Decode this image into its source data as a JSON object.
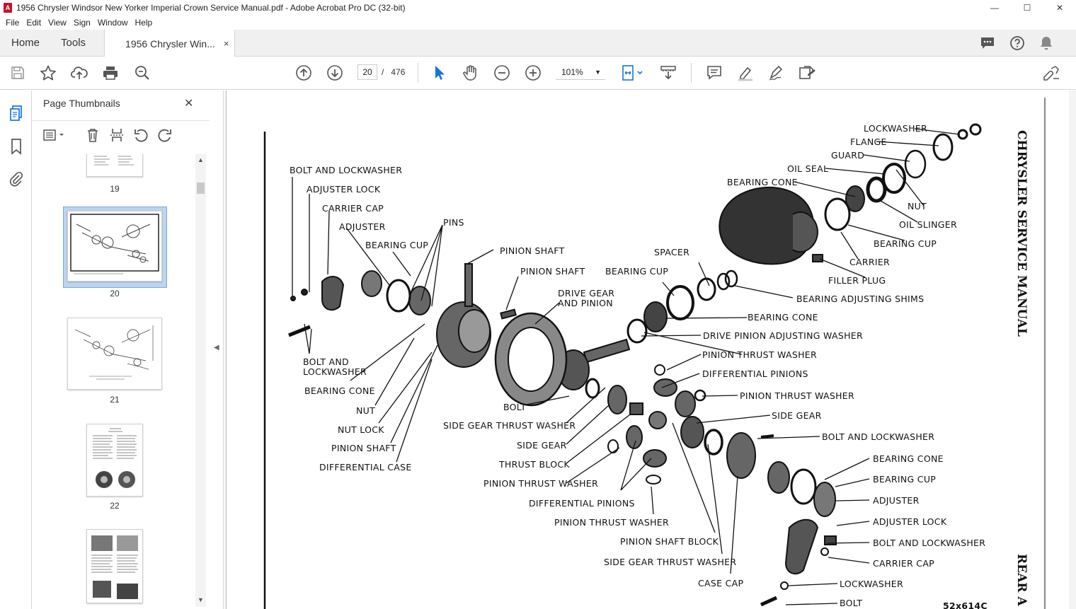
{
  "window": {
    "title": "1956 Chrysler Windsor New Yorker Imperial Crown Service Manual.pdf - Adobe Acrobat Pro DC (32-bit)",
    "app_icon": "A",
    "minimize": "—",
    "maximize": "☐",
    "close": "✕"
  },
  "menu": [
    "File",
    "Edit",
    "View",
    "Sign",
    "Window",
    "Help"
  ],
  "tabs": {
    "home": "Home",
    "tools": "Tools",
    "doc": "1956 Chrysler Win...",
    "doc_close": "×"
  },
  "toolbar": {
    "page_current": "20",
    "page_sep": "/",
    "page_total": "476",
    "zoom": "101%"
  },
  "panel": {
    "title": "Page Thumbnails",
    "close": "✕",
    "thumbnails": [
      {
        "label": "19"
      },
      {
        "label": "20",
        "selected": true
      },
      {
        "label": "21"
      },
      {
        "label": "22"
      },
      {
        "label": ""
      }
    ]
  },
  "document": {
    "side_title": "CHRYSLER SERVICE MANUAL",
    "side_footer": "REAR A",
    "figure_number": "52x614C",
    "labels": [
      "LOCKWASHER",
      "FLANGE",
      "GUARD",
      "OIL SEAL",
      "BEARING CONE",
      "NUT",
      "OIL SLINGER",
      "BEARING CUP",
      "CARRIER",
      "FILLER PLUG",
      "BEARING ADJUSTING SHIMS",
      "SPACER",
      "BEARING CUP",
      "BEARING CONE",
      "DRIVE PINION ADJUSTING WASHER",
      "PINION THRUST WASHER",
      "DIFFERENTIAL PINIONS",
      "PINION THRUST WASHER",
      "SIDE GEAR",
      "BOLT AND LOCKWASHER",
      "BEARING CONE",
      "BEARING CUP",
      "ADJUSTER",
      "ADJUSTER LOCK",
      "BOLT AND LOCKWASHER",
      "CARRIER CAP",
      "LOCKWASHER",
      "BOLT",
      "BOLT AND LOCKWASHER",
      "ADJUSTER LOCK",
      "CARRIER CAP",
      "ADJUSTER",
      "BEARING CUP",
      "PINS",
      "PINION SHAFT",
      "PINION SHAFT",
      "DRIVE GEAR",
      "AND PINION",
      "BOLT AND",
      "LOCKWASHER",
      "BEARING CONE",
      "NUT",
      "NUT LOCK",
      "PINION SHAFT",
      "DIFFERENTIAL CASE",
      "BOLT",
      "SIDE GEAR THRUST WASHER",
      "SIDE GEAR",
      "THRUST BLOCK",
      "PINION THRUST WASHER",
      "DIFFERENTIAL PINIONS",
      "PINION THRUST WASHER",
      "PINION SHAFT BLOCK",
      "SIDE GEAR THRUST WASHER",
      "CASE CAP"
    ]
  }
}
